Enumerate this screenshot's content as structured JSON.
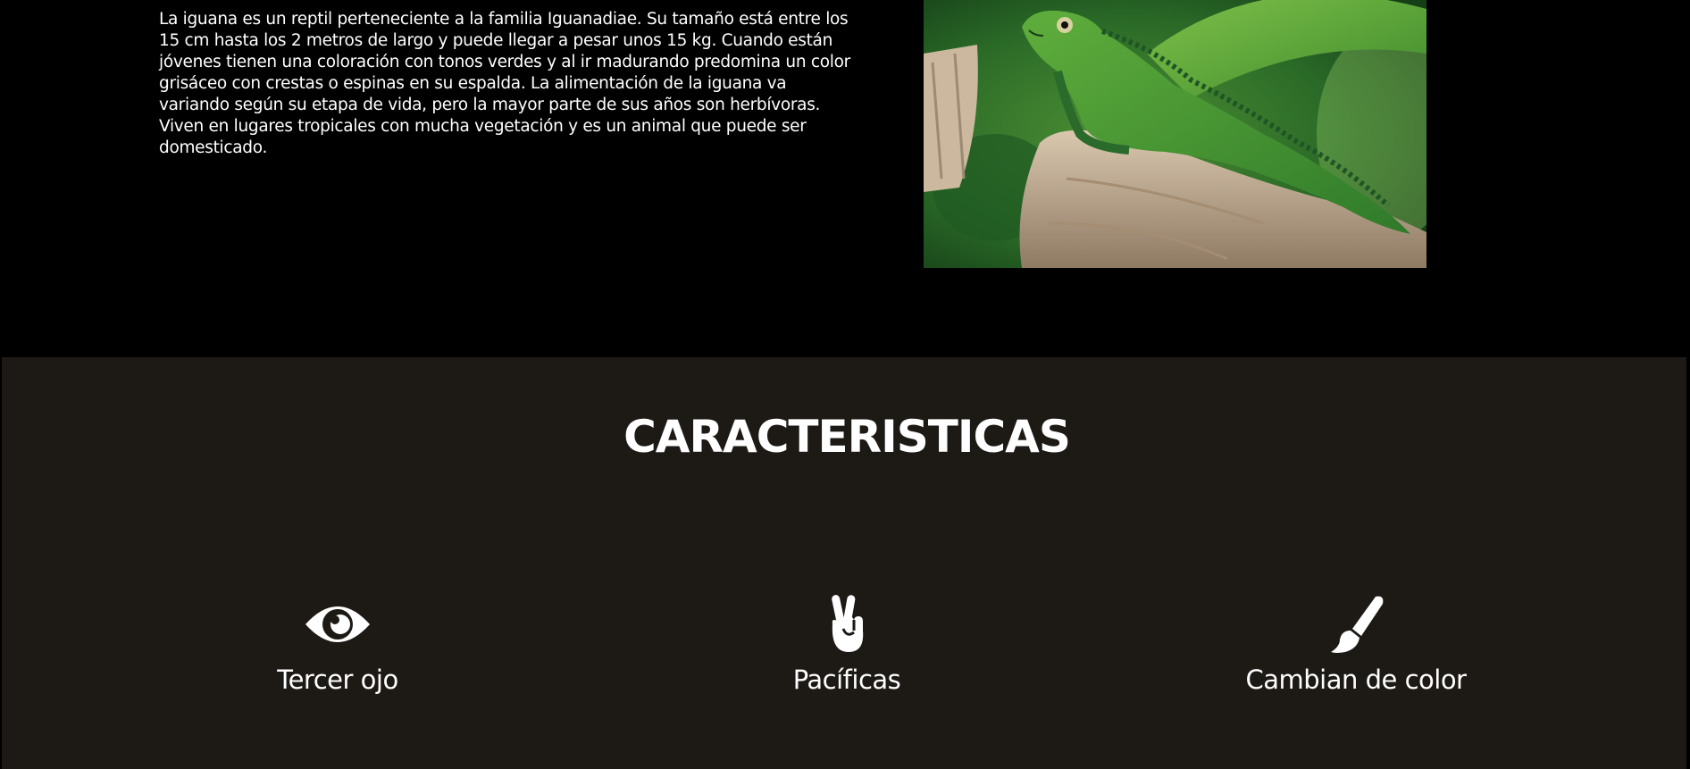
{
  "intro": {
    "text": "La iguana es un reptil perteneciente a la familia Iguanadiae. Su tamaño está entre los 15 cm hasta los 2 metros de largo y puede llegar a pesar unos 15 kg. Cuando están jóvenes tienen una coloración con tonos verdes y al ir madurando predomina un color grisáceo con crestas o espinas en su espalda. La alimentación de la iguana va variando según su etapa de vida, pero la mayor parte de sus años son herbívoras. Viven en lugares tropicales con mucha vegetación y es un animal que puede ser domesticado.",
    "image_subject": "green-iguana-on-tree-stump"
  },
  "features": {
    "title": "CARACTERISTICAS",
    "items": [
      {
        "icon": "eye-icon",
        "label": "Tercer ojo"
      },
      {
        "icon": "peace-hand-icon",
        "label": "Pacíficas"
      },
      {
        "icon": "paintbrush-icon",
        "label": "Cambian de color"
      }
    ]
  },
  "colors": {
    "page_background": "#000000",
    "features_background": "#1d1915",
    "text": "#ffffff"
  }
}
